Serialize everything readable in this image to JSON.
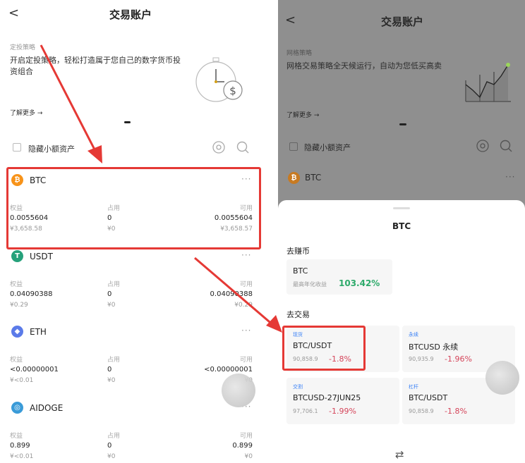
{
  "left": {
    "back": "<",
    "title": "交易账户",
    "banner": {
      "tag": "定投策略",
      "text": "开启定投策略，轻松打造属于您自己的数字货币投资组合",
      "more": "了解更多 →"
    },
    "hide_small": "隐藏小额资产",
    "assets": [
      {
        "name": "BTC",
        "icon": "₿",
        "icon_color": "#f7931a",
        "labels": [
          "权益",
          "占用",
          "可用"
        ],
        "equity": "0.0055604",
        "equity_cny": "¥3,658.58",
        "used": "0",
        "used_cny": "¥0",
        "avail": "0.0055604",
        "avail_cny": "¥3,658.57"
      },
      {
        "name": "USDT",
        "icon": "T",
        "icon_color": "#26a17b",
        "labels": [
          "权益",
          "占用",
          "可用"
        ],
        "equity": "0.04090388",
        "equity_cny": "¥0.29",
        "used": "0",
        "used_cny": "¥0",
        "avail": "0.04090388",
        "avail_cny": "¥0.29"
      },
      {
        "name": "ETH",
        "icon": "◆",
        "icon_color": "#5b7be9",
        "labels": [
          "权益",
          "占用",
          "可用"
        ],
        "equity": "<0.00000001",
        "equity_cny": "¥<0.01",
        "used": "0",
        "used_cny": "¥0",
        "avail": "<0.00000001",
        "avail_cny": "¥0"
      },
      {
        "name": "AIDOGE",
        "icon": "◎",
        "icon_color": "#3a9bd8",
        "labels": [
          "权益",
          "占用",
          "可用"
        ],
        "equity": "0.899",
        "equity_cny": "¥<0.01",
        "used": "0",
        "used_cny": "¥0",
        "avail": "0.899",
        "avail_cny": "¥0"
      }
    ]
  },
  "right": {
    "back": "<",
    "title": "交易账户",
    "banner": {
      "tag": "网格策略",
      "text": "网格交易策略全天候运行，自动为您低买高卖",
      "more": "了解更多 →"
    },
    "hide_small": "隐藏小额资产",
    "coin": "BTC",
    "sheet": {
      "title": "BTC",
      "earn_title": "去赚币",
      "earn_coin": "BTC",
      "earn_label": "最高年化收益",
      "earn_rate": "103.42%",
      "trade_title": "去交易",
      "cards": [
        {
          "tag": "现货",
          "name": "BTC/USDT",
          "price": "90,858.9",
          "change": "-1.8%"
        },
        {
          "tag": "永续",
          "name": "BTCUSD 永续",
          "price": "90,935.9",
          "change": "-1.96%"
        },
        {
          "tag": "交割",
          "name": "BTCUSD-27JUN25",
          "price": "97,706.1",
          "change": "-1.99%"
        },
        {
          "tag": "杠杆",
          "name": "BTC/USDT",
          "price": "90,858.9",
          "change": "-1.8%"
        }
      ],
      "swap": "⇄"
    }
  },
  "colors": {
    "highlight": "#e53935",
    "negative": "#d5455a",
    "positive": "#2eaa6b"
  }
}
